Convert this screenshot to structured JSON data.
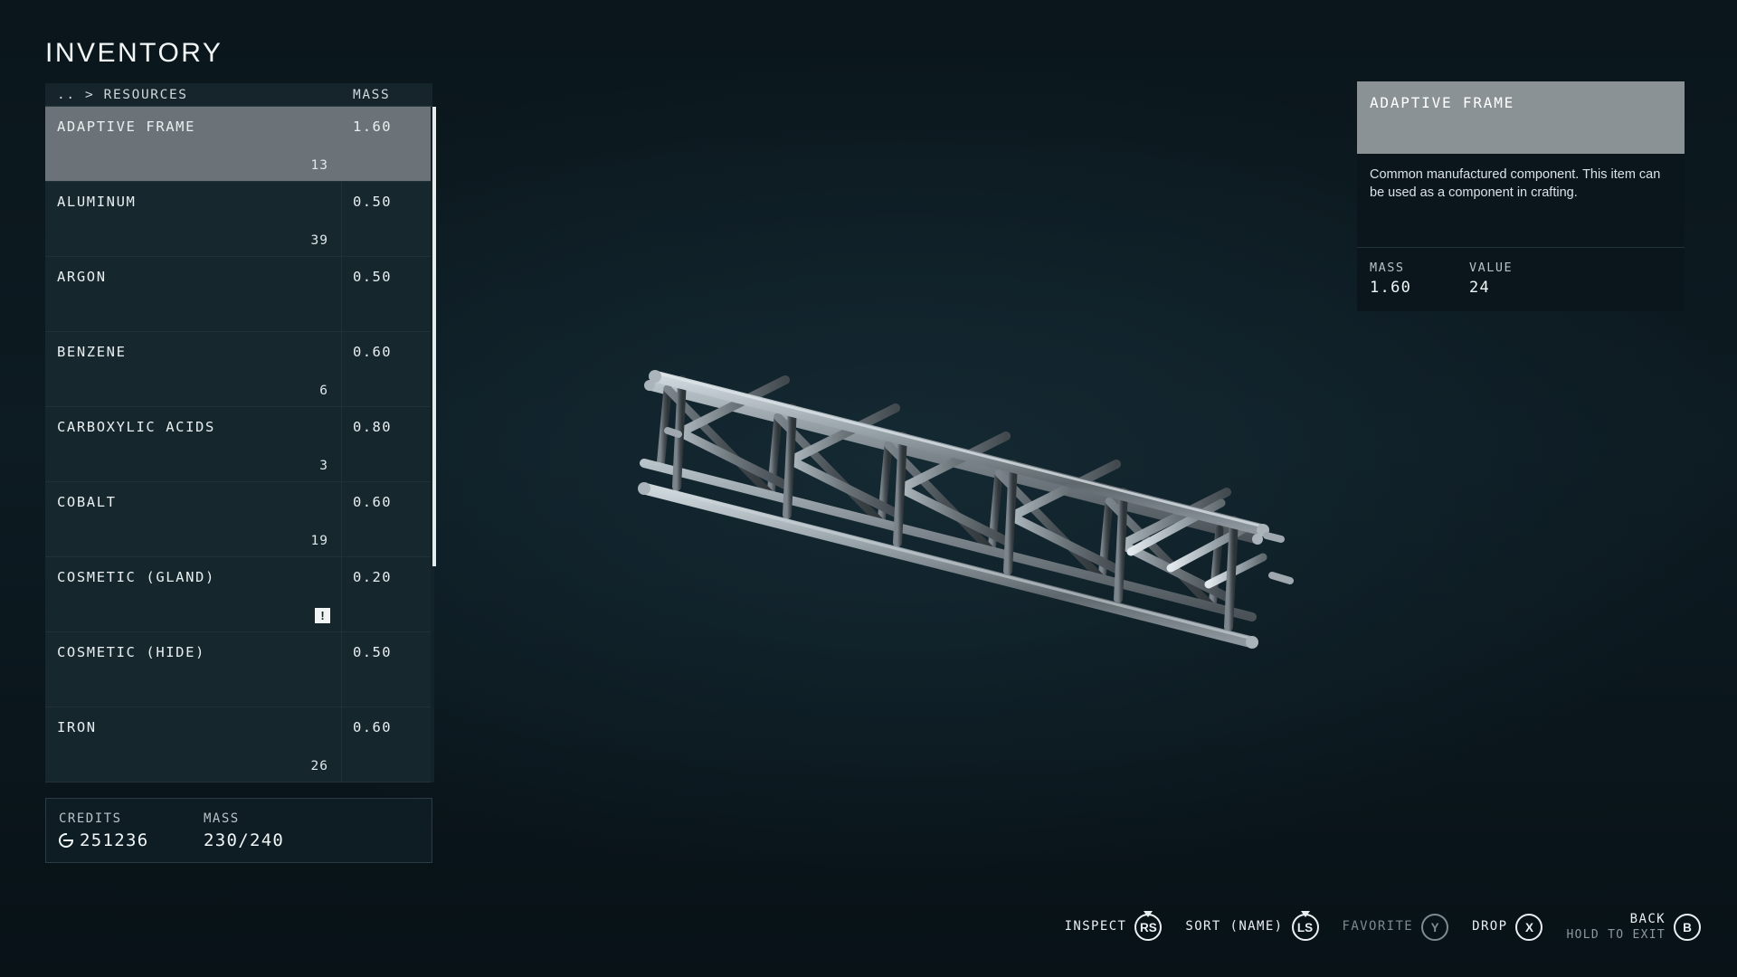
{
  "screen": {
    "title": "INVENTORY",
    "background_color": "#0c191f",
    "accent_select_color": "#6b7378"
  },
  "list": {
    "breadcrumb": ".. > RESOURCES",
    "mass_column_header": "MASS",
    "rows": [
      {
        "name": "ADAPTIVE FRAME",
        "count": "13",
        "mass": "1.60",
        "selected": true,
        "new": false
      },
      {
        "name": "ALUMINUM",
        "count": "39",
        "mass": "0.50",
        "selected": false,
        "new": false
      },
      {
        "name": "ARGON",
        "count": "",
        "mass": "0.50",
        "selected": false,
        "new": false
      },
      {
        "name": "BENZENE",
        "count": "6",
        "mass": "0.60",
        "selected": false,
        "new": false
      },
      {
        "name": "CARBOXYLIC ACIDS",
        "count": "3",
        "mass": "0.80",
        "selected": false,
        "new": false
      },
      {
        "name": "COBALT",
        "count": "19",
        "mass": "0.60",
        "selected": false,
        "new": false
      },
      {
        "name": "COSMETIC (GLAND)",
        "count": "",
        "mass": "0.20",
        "selected": false,
        "new": true,
        "new_badge": "!"
      },
      {
        "name": "COSMETIC (HIDE)",
        "count": "",
        "mass": "0.50",
        "selected": false,
        "new": false
      },
      {
        "name": "IRON",
        "count": "26",
        "mass": "0.60",
        "selected": false,
        "new": false
      }
    ],
    "scroll_thumb_percent": 68
  },
  "footer": {
    "credits_label": "CREDITS",
    "credits_value": "251236",
    "credits_icon": "credit-icon",
    "mass_label": "MASS",
    "mass_value": "230/240"
  },
  "detail": {
    "title": "ADAPTIVE FRAME",
    "description": "Common manufactured component. This item can be used as a component in crafting.",
    "mass_label": "MASS",
    "mass_value": "1.60",
    "value_label": "VALUE",
    "value_value": "24"
  },
  "model": {
    "name": "truss-beam-model"
  },
  "actions": [
    {
      "label": "INSPECT",
      "glyph": "RS",
      "stick": true,
      "dim": false,
      "sub": ""
    },
    {
      "label": "SORT (NAME)",
      "glyph": "LS",
      "stick": true,
      "dim": false,
      "sub": ""
    },
    {
      "label": "FAVORITE",
      "glyph": "Y",
      "stick": false,
      "dim": true,
      "sub": ""
    },
    {
      "label": "DROP",
      "glyph": "X",
      "stick": false,
      "dim": false,
      "sub": ""
    },
    {
      "label": "BACK",
      "glyph": "B",
      "stick": false,
      "dim": false,
      "sub": "HOLD TO EXIT"
    }
  ]
}
